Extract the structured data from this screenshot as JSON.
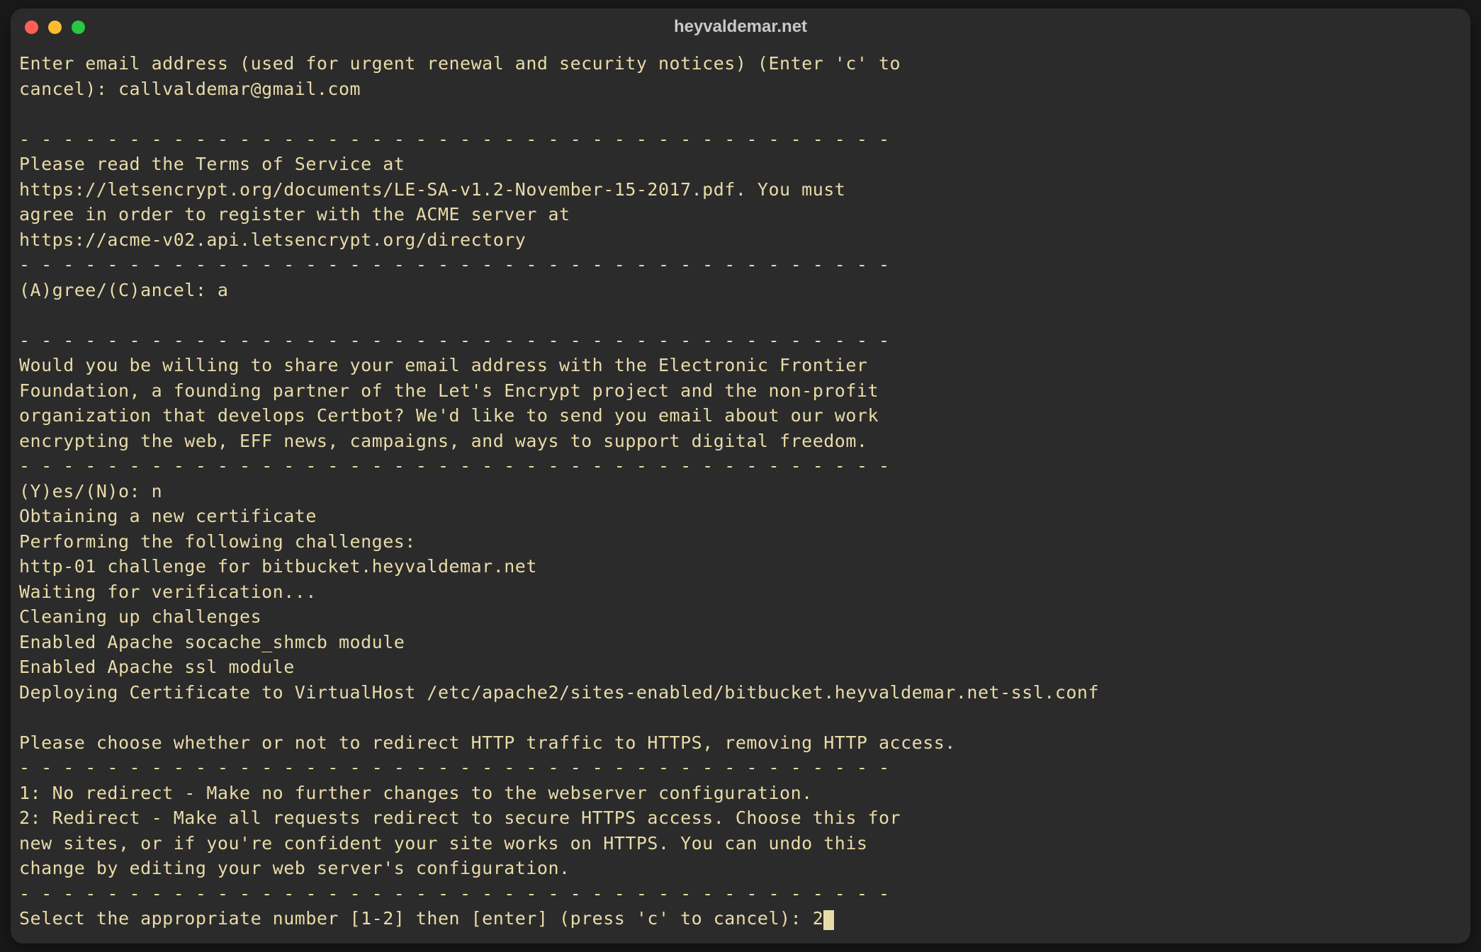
{
  "titlebar": {
    "title": "heyvaldemar.net"
  },
  "terminal": {
    "line01": "Enter email address (used for urgent renewal and security notices) (Enter 'c' to",
    "line02": "cancel): callvaldemar@gmail.com",
    "line03": "",
    "line04": "- - - - - - - - - - - - - - - - - - - - - - - - - - - - - - - - - - - - - - - -",
    "line05": "Please read the Terms of Service at",
    "line06": "https://letsencrypt.org/documents/LE-SA-v1.2-November-15-2017.pdf. You must",
    "line07": "agree in order to register with the ACME server at",
    "line08": "https://acme-v02.api.letsencrypt.org/directory",
    "line09": "- - - - - - - - - - - - - - - - - - - - - - - - - - - - - - - - - - - - - - - -",
    "line10": "(A)gree/(C)ancel: a",
    "line11": "",
    "line12": "- - - - - - - - - - - - - - - - - - - - - - - - - - - - - - - - - - - - - - - -",
    "line13": "Would you be willing to share your email address with the Electronic Frontier",
    "line14": "Foundation, a founding partner of the Let's Encrypt project and the non-profit",
    "line15": "organization that develops Certbot? We'd like to send you email about our work",
    "line16": "encrypting the web, EFF news, campaigns, and ways to support digital freedom.",
    "line17": "- - - - - - - - - - - - - - - - - - - - - - - - - - - - - - - - - - - - - - - -",
    "line18": "(Y)es/(N)o: n",
    "line19": "Obtaining a new certificate",
    "line20": "Performing the following challenges:",
    "line21": "http-01 challenge for bitbucket.heyvaldemar.net",
    "line22": "Waiting for verification...",
    "line23": "Cleaning up challenges",
    "line24": "Enabled Apache socache_shmcb module",
    "line25": "Enabled Apache ssl module",
    "line26": "Deploying Certificate to VirtualHost /etc/apache2/sites-enabled/bitbucket.heyvaldemar.net-ssl.conf",
    "line27": "",
    "line28": "Please choose whether or not to redirect HTTP traffic to HTTPS, removing HTTP access.",
    "line29": "- - - - - - - - - - - - - - - - - - - - - - - - - - - - - - - - - - - - - - - -",
    "line30": "1: No redirect - Make no further changes to the webserver configuration.",
    "line31": "2: Redirect - Make all requests redirect to secure HTTPS access. Choose this for",
    "line32": "new sites, or if you're confident your site works on HTTPS. You can undo this",
    "line33": "change by editing your web server's configuration.",
    "line34": "- - - - - - - - - - - - - - - - - - - - - - - - - - - - - - - - - - - - - - - -",
    "line35": "Select the appropriate number [1-2] then [enter] (press 'c' to cancel): 2"
  }
}
